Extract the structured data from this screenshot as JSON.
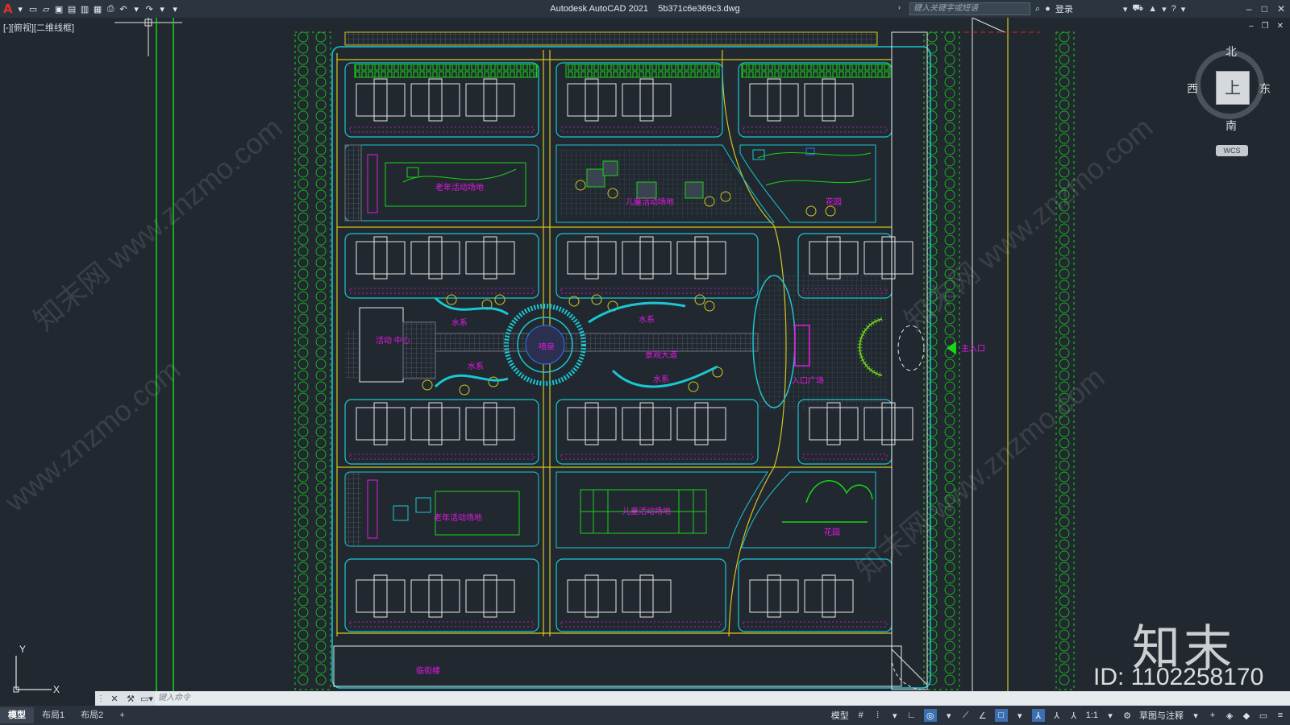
{
  "titlebar": {
    "app": "Autodesk AutoCAD 2021",
    "file": "5b371c6e369c3.dwg",
    "search_placeholder": "键入关键字或短语",
    "login_label": "登录"
  },
  "viewport_label": "[-][俯视][二维线框]",
  "viewcube": {
    "north": "北",
    "south": "南",
    "east": "东",
    "west": "西",
    "top": "上",
    "wcs": "WCS"
  },
  "plan_labels": {
    "elderly_area_top": "老年活动场地",
    "children_area_top": "儿童活动场地",
    "garden_top": "花园",
    "water_1": "水系",
    "water_2": "水系",
    "water_3": "水系",
    "water_4": "水系",
    "activity_center": "活动\n中心",
    "fountain": "喷泉",
    "scenic_avenue": "景观大道",
    "entrance_plaza": "入口广场",
    "main_entrance": "主入口",
    "elderly_area_bottom": "老年活动场地",
    "children_area_bottom": "儿童活动场地",
    "garden_bottom": "花园",
    "street_building": "临街楼"
  },
  "watermarks": {
    "site": "www.znzmo.com",
    "brand_cn": "知末网",
    "brand_big": "知末",
    "id": "ID: 1102258170"
  },
  "command": {
    "placeholder": "键入命令"
  },
  "tabs": [
    {
      "label": "模型",
      "active": true
    },
    {
      "label": "布局1",
      "active": false
    },
    {
      "label": "布局2",
      "active": false
    }
  ],
  "status": {
    "model": "模型",
    "scale": "1:1",
    "workspace": "草图与注释"
  },
  "ucs": {
    "x": "X",
    "y": "Y"
  },
  "colors": {
    "background": "#212830",
    "green": "#19d419",
    "cyan": "#19c8d2",
    "magenta": "#e619e6",
    "yellow": "#d2c81e",
    "white": "#e6e6e6"
  }
}
